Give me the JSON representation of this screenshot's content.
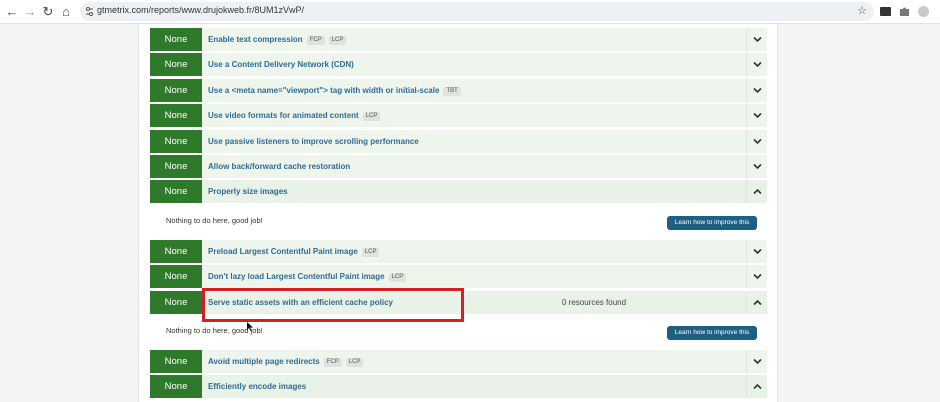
{
  "browser": {
    "url": "gtmetrix.com/reports/www.drujokweb.fr/8UM1zVwP/",
    "icons": [
      "back-icon",
      "forward-icon",
      "reload-icon",
      "home-icon",
      "site-settings-icon",
      "star-icon",
      "extension-icons"
    ]
  },
  "audits": [
    {
      "score": "None",
      "title": "Enable text compression",
      "tags": [
        "FCP",
        "LCP"
      ],
      "expanded": false
    },
    {
      "score": "None",
      "title": "Use a Content Delivery Network (CDN)",
      "tags": [],
      "expanded": false
    },
    {
      "score": "None",
      "title": "Use a <meta name=\"viewport\"> tag with width or initial-scale",
      "tags": [
        "TBT"
      ],
      "expanded": false
    },
    {
      "score": "None",
      "title": "Use video formats for animated content",
      "tags": [
        "LCP"
      ],
      "expanded": false
    },
    {
      "score": "None",
      "title": "Use passive listeners to improve scrolling performance",
      "tags": [],
      "expanded": false
    },
    {
      "score": "None",
      "title": "Allow back/forward cache restoration",
      "tags": [],
      "expanded": false
    },
    {
      "score": "None",
      "title": "Properly size images",
      "tags": [],
      "expanded": true,
      "detail": "Nothing to do here, good job!",
      "button": "Learn how to improve this"
    },
    {
      "score": "None",
      "title": "Preload Largest Contentful Paint image",
      "tags": [
        "LCP"
      ],
      "expanded": false
    },
    {
      "score": "None",
      "title": "Don't lazy load Largest Contentful Paint image",
      "tags": [
        "LCP"
      ],
      "expanded": false
    },
    {
      "score": "None",
      "title": "Serve static assets with an efficient cache policy",
      "tags": [],
      "expanded": true,
      "resources": "0 resources found",
      "detail": "Nothing to do here, good job!",
      "button": "Learn how to improve this"
    },
    {
      "score": "None",
      "title": "Avoid multiple page redirects",
      "tags": [
        "FCP",
        "LCP"
      ],
      "expanded": false
    },
    {
      "score": "None",
      "title": "Efficiently encode images",
      "tags": [],
      "expanded": true
    }
  ],
  "colors": {
    "score_bg": "#2f7a2a",
    "title": "#2e6b93",
    "button": "#1e5f84",
    "highlight": "#d42024"
  }
}
